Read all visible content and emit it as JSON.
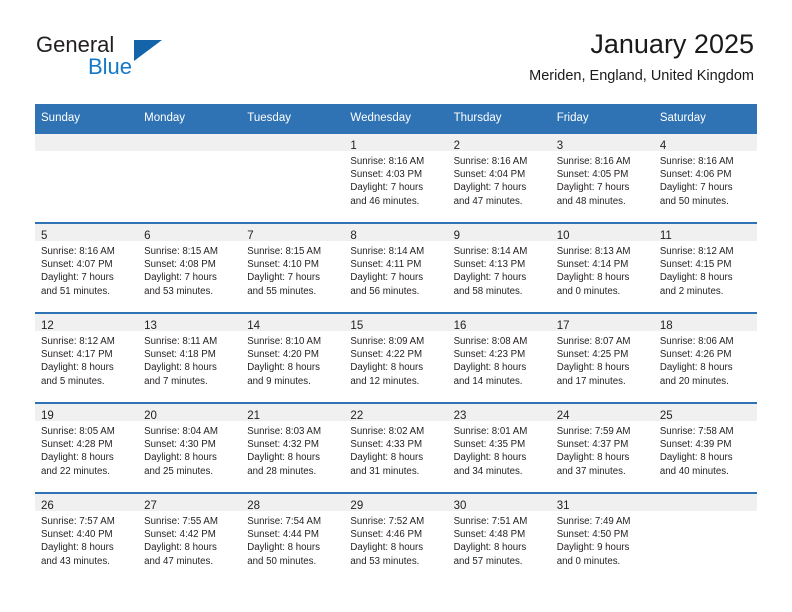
{
  "brand": {
    "name_part1": "General",
    "name_part2": "Blue",
    "triangle_color": "#1464aa",
    "blue_color": "#1478c8"
  },
  "header": {
    "title": "January 2025",
    "subtitle": "Meriden, England, United Kingdom",
    "accent_color": "#2f73b4",
    "daynum_band_color": "#f0f0f0"
  },
  "weekday_headers": [
    "Sunday",
    "Monday",
    "Tuesday",
    "Wednesday",
    "Thursday",
    "Friday",
    "Saturday"
  ],
  "weeks": [
    [
      {
        "day": "",
        "sunrise": "",
        "sunset": "",
        "daylight_line1": "",
        "daylight_line2": ""
      },
      {
        "day": "",
        "sunrise": "",
        "sunset": "",
        "daylight_line1": "",
        "daylight_line2": ""
      },
      {
        "day": "",
        "sunrise": "",
        "sunset": "",
        "daylight_line1": "",
        "daylight_line2": ""
      },
      {
        "day": "1",
        "sunrise": "Sunrise: 8:16 AM",
        "sunset": "Sunset: 4:03 PM",
        "daylight_line1": "Daylight: 7 hours",
        "daylight_line2": "and 46 minutes."
      },
      {
        "day": "2",
        "sunrise": "Sunrise: 8:16 AM",
        "sunset": "Sunset: 4:04 PM",
        "daylight_line1": "Daylight: 7 hours",
        "daylight_line2": "and 47 minutes."
      },
      {
        "day": "3",
        "sunrise": "Sunrise: 8:16 AM",
        "sunset": "Sunset: 4:05 PM",
        "daylight_line1": "Daylight: 7 hours",
        "daylight_line2": "and 48 minutes."
      },
      {
        "day": "4",
        "sunrise": "Sunrise: 8:16 AM",
        "sunset": "Sunset: 4:06 PM",
        "daylight_line1": "Daylight: 7 hours",
        "daylight_line2": "and 50 minutes."
      }
    ],
    [
      {
        "day": "5",
        "sunrise": "Sunrise: 8:16 AM",
        "sunset": "Sunset: 4:07 PM",
        "daylight_line1": "Daylight: 7 hours",
        "daylight_line2": "and 51 minutes."
      },
      {
        "day": "6",
        "sunrise": "Sunrise: 8:15 AM",
        "sunset": "Sunset: 4:08 PM",
        "daylight_line1": "Daylight: 7 hours",
        "daylight_line2": "and 53 minutes."
      },
      {
        "day": "7",
        "sunrise": "Sunrise: 8:15 AM",
        "sunset": "Sunset: 4:10 PM",
        "daylight_line1": "Daylight: 7 hours",
        "daylight_line2": "and 55 minutes."
      },
      {
        "day": "8",
        "sunrise": "Sunrise: 8:14 AM",
        "sunset": "Sunset: 4:11 PM",
        "daylight_line1": "Daylight: 7 hours",
        "daylight_line2": "and 56 minutes."
      },
      {
        "day": "9",
        "sunrise": "Sunrise: 8:14 AM",
        "sunset": "Sunset: 4:13 PM",
        "daylight_line1": "Daylight: 7 hours",
        "daylight_line2": "and 58 minutes."
      },
      {
        "day": "10",
        "sunrise": "Sunrise: 8:13 AM",
        "sunset": "Sunset: 4:14 PM",
        "daylight_line1": "Daylight: 8 hours",
        "daylight_line2": "and 0 minutes."
      },
      {
        "day": "11",
        "sunrise": "Sunrise: 8:12 AM",
        "sunset": "Sunset: 4:15 PM",
        "daylight_line1": "Daylight: 8 hours",
        "daylight_line2": "and 2 minutes."
      }
    ],
    [
      {
        "day": "12",
        "sunrise": "Sunrise: 8:12 AM",
        "sunset": "Sunset: 4:17 PM",
        "daylight_line1": "Daylight: 8 hours",
        "daylight_line2": "and 5 minutes."
      },
      {
        "day": "13",
        "sunrise": "Sunrise: 8:11 AM",
        "sunset": "Sunset: 4:18 PM",
        "daylight_line1": "Daylight: 8 hours",
        "daylight_line2": "and 7 minutes."
      },
      {
        "day": "14",
        "sunrise": "Sunrise: 8:10 AM",
        "sunset": "Sunset: 4:20 PM",
        "daylight_line1": "Daylight: 8 hours",
        "daylight_line2": "and 9 minutes."
      },
      {
        "day": "15",
        "sunrise": "Sunrise: 8:09 AM",
        "sunset": "Sunset: 4:22 PM",
        "daylight_line1": "Daylight: 8 hours",
        "daylight_line2": "and 12 minutes."
      },
      {
        "day": "16",
        "sunrise": "Sunrise: 8:08 AM",
        "sunset": "Sunset: 4:23 PM",
        "daylight_line1": "Daylight: 8 hours",
        "daylight_line2": "and 14 minutes."
      },
      {
        "day": "17",
        "sunrise": "Sunrise: 8:07 AM",
        "sunset": "Sunset: 4:25 PM",
        "daylight_line1": "Daylight: 8 hours",
        "daylight_line2": "and 17 minutes."
      },
      {
        "day": "18",
        "sunrise": "Sunrise: 8:06 AM",
        "sunset": "Sunset: 4:26 PM",
        "daylight_line1": "Daylight: 8 hours",
        "daylight_line2": "and 20 minutes."
      }
    ],
    [
      {
        "day": "19",
        "sunrise": "Sunrise: 8:05 AM",
        "sunset": "Sunset: 4:28 PM",
        "daylight_line1": "Daylight: 8 hours",
        "daylight_line2": "and 22 minutes."
      },
      {
        "day": "20",
        "sunrise": "Sunrise: 8:04 AM",
        "sunset": "Sunset: 4:30 PM",
        "daylight_line1": "Daylight: 8 hours",
        "daylight_line2": "and 25 minutes."
      },
      {
        "day": "21",
        "sunrise": "Sunrise: 8:03 AM",
        "sunset": "Sunset: 4:32 PM",
        "daylight_line1": "Daylight: 8 hours",
        "daylight_line2": "and 28 minutes."
      },
      {
        "day": "22",
        "sunrise": "Sunrise: 8:02 AM",
        "sunset": "Sunset: 4:33 PM",
        "daylight_line1": "Daylight: 8 hours",
        "daylight_line2": "and 31 minutes."
      },
      {
        "day": "23",
        "sunrise": "Sunrise: 8:01 AM",
        "sunset": "Sunset: 4:35 PM",
        "daylight_line1": "Daylight: 8 hours",
        "daylight_line2": "and 34 minutes."
      },
      {
        "day": "24",
        "sunrise": "Sunrise: 7:59 AM",
        "sunset": "Sunset: 4:37 PM",
        "daylight_line1": "Daylight: 8 hours",
        "daylight_line2": "and 37 minutes."
      },
      {
        "day": "25",
        "sunrise": "Sunrise: 7:58 AM",
        "sunset": "Sunset: 4:39 PM",
        "daylight_line1": "Daylight: 8 hours",
        "daylight_line2": "and 40 minutes."
      }
    ],
    [
      {
        "day": "26",
        "sunrise": "Sunrise: 7:57 AM",
        "sunset": "Sunset: 4:40 PM",
        "daylight_line1": "Daylight: 8 hours",
        "daylight_line2": "and 43 minutes."
      },
      {
        "day": "27",
        "sunrise": "Sunrise: 7:55 AM",
        "sunset": "Sunset: 4:42 PM",
        "daylight_line1": "Daylight: 8 hours",
        "daylight_line2": "and 47 minutes."
      },
      {
        "day": "28",
        "sunrise": "Sunrise: 7:54 AM",
        "sunset": "Sunset: 4:44 PM",
        "daylight_line1": "Daylight: 8 hours",
        "daylight_line2": "and 50 minutes."
      },
      {
        "day": "29",
        "sunrise": "Sunrise: 7:52 AM",
        "sunset": "Sunset: 4:46 PM",
        "daylight_line1": "Daylight: 8 hours",
        "daylight_line2": "and 53 minutes."
      },
      {
        "day": "30",
        "sunrise": "Sunrise: 7:51 AM",
        "sunset": "Sunset: 4:48 PM",
        "daylight_line1": "Daylight: 8 hours",
        "daylight_line2": "and 57 minutes."
      },
      {
        "day": "31",
        "sunrise": "Sunrise: 7:49 AM",
        "sunset": "Sunset: 4:50 PM",
        "daylight_line1": "Daylight: 9 hours",
        "daylight_line2": "and 0 minutes."
      },
      {
        "day": "",
        "sunrise": "",
        "sunset": "",
        "daylight_line1": "",
        "daylight_line2": ""
      }
    ]
  ]
}
